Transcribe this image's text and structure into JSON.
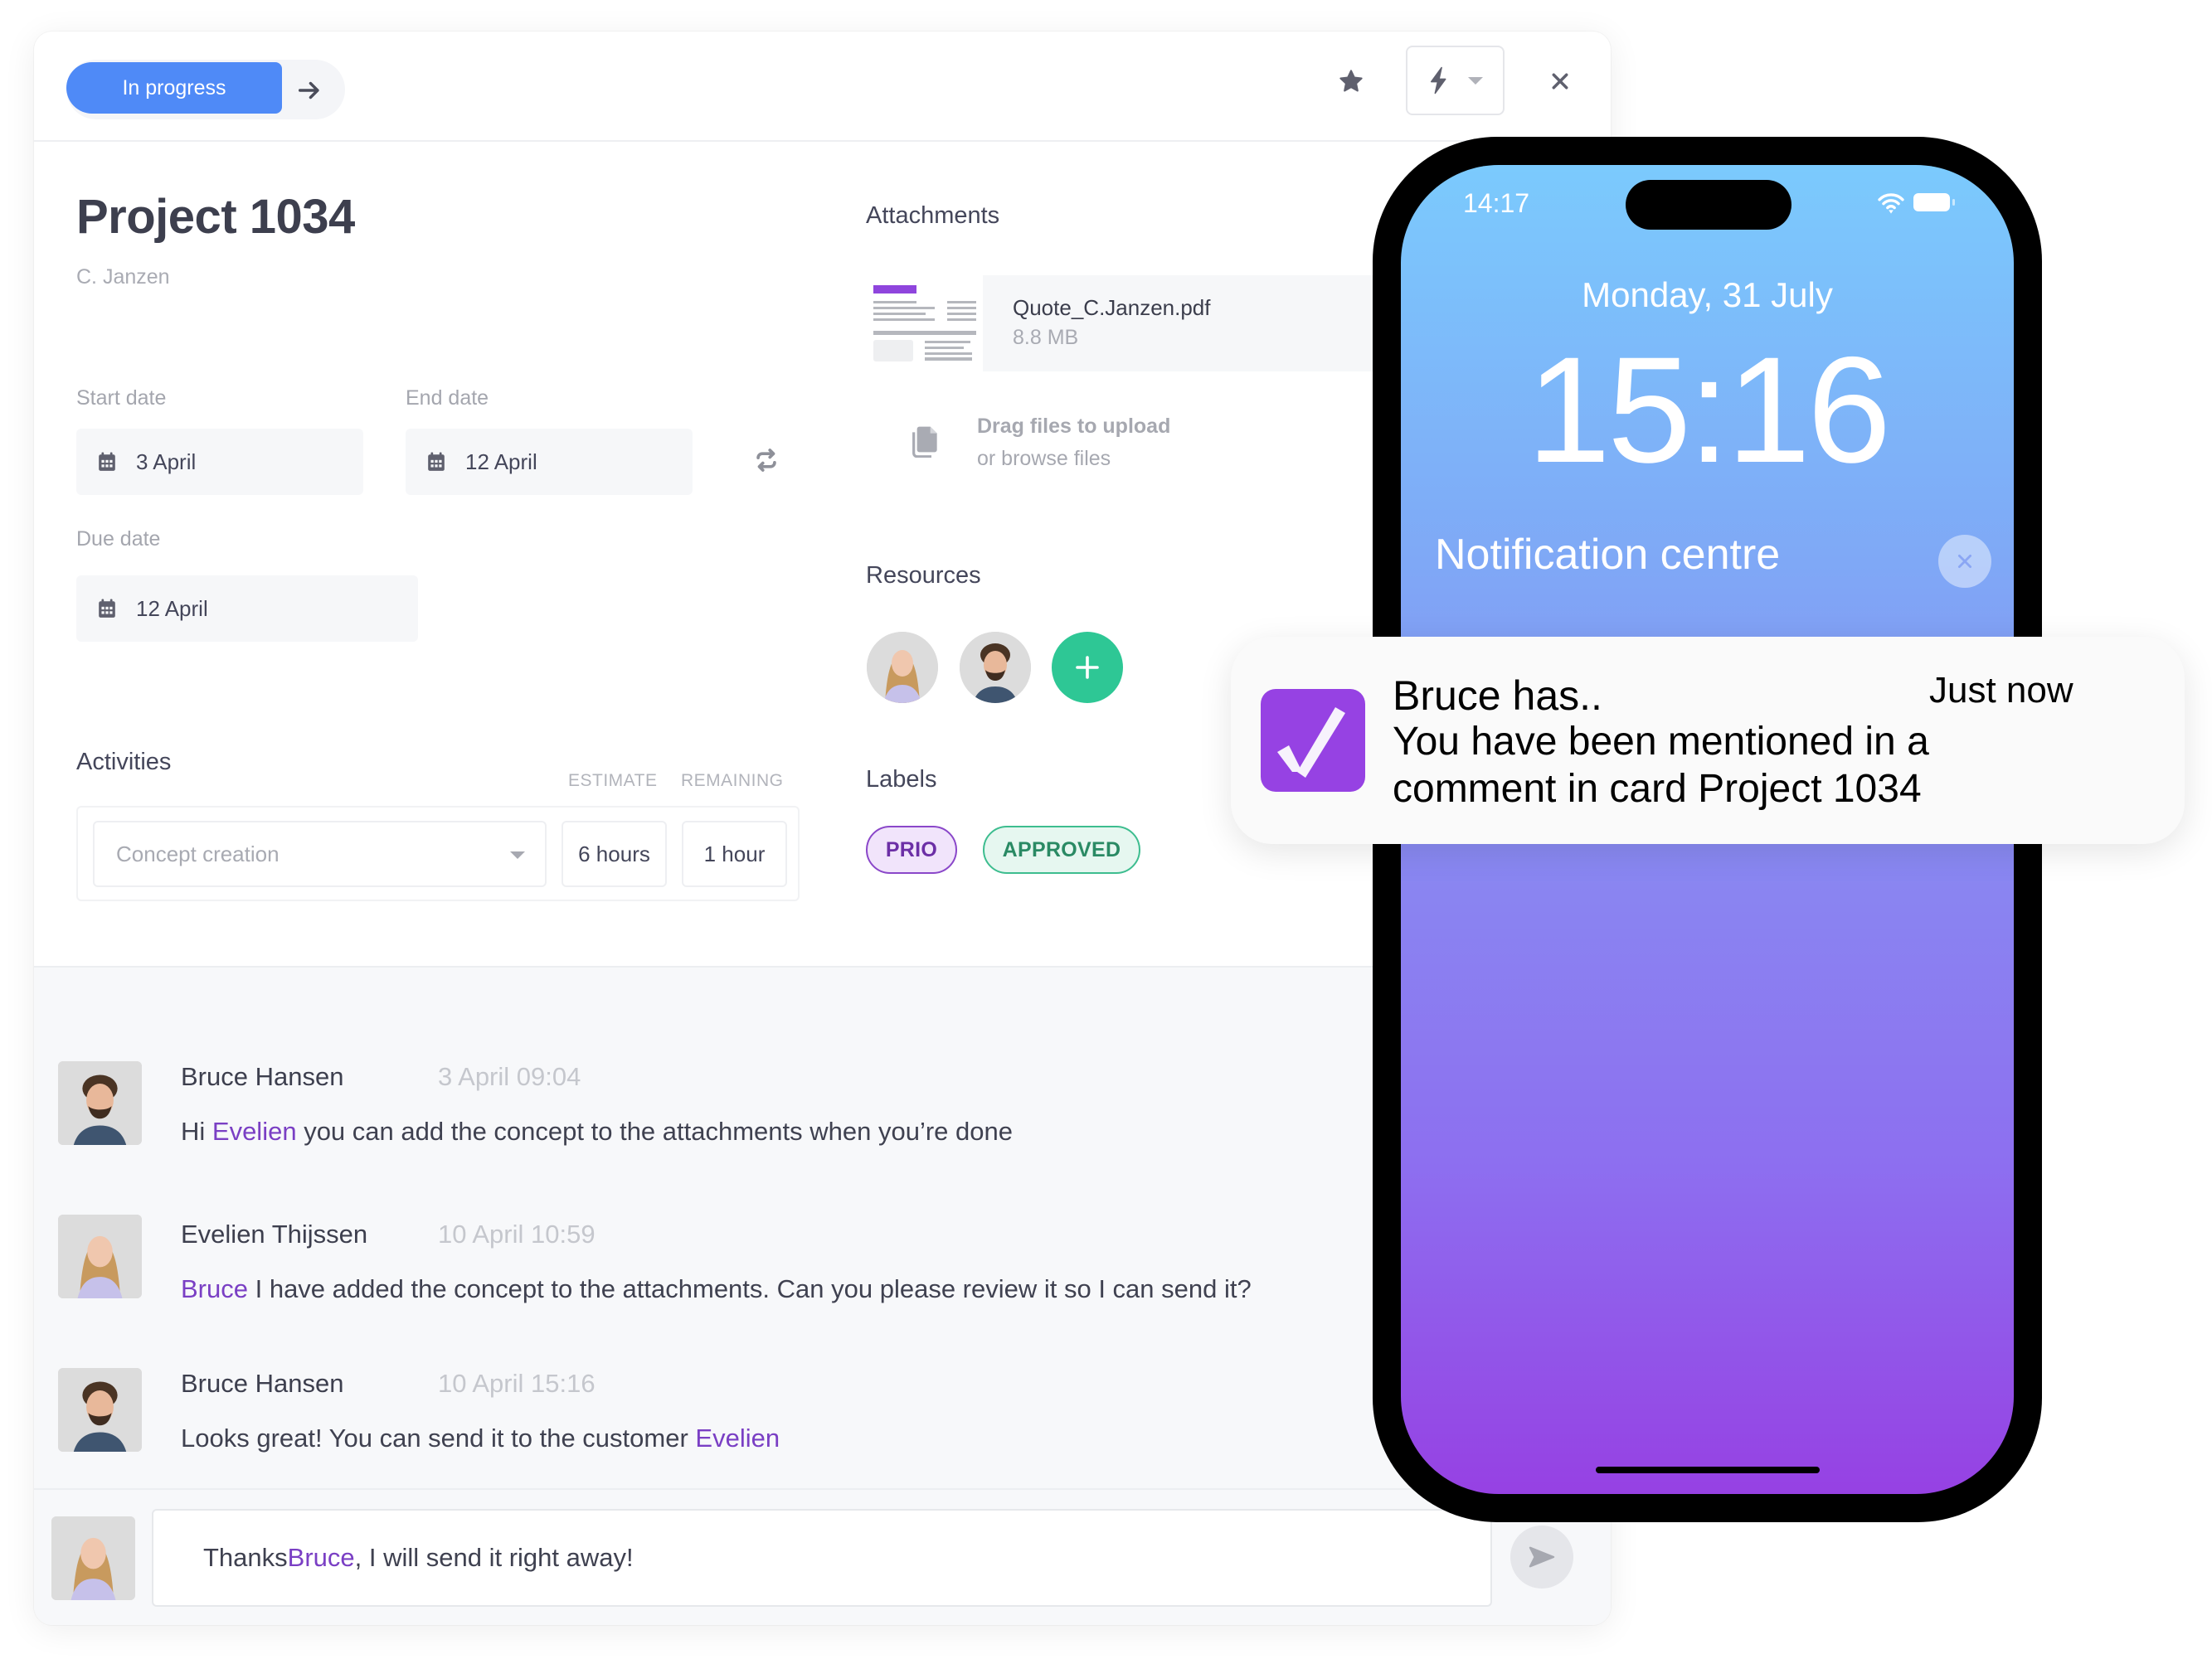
{
  "card": {
    "status": {
      "label": "In progress",
      "color": "#4f8af7",
      "next_icon": "arrow-right-icon"
    },
    "toolbar": {
      "star_icon": "star-icon",
      "automation_icon": "lightning-icon",
      "close_icon": "close-icon"
    },
    "title": "Project 1034",
    "subtitle": "C. Janzen",
    "dates": {
      "start_label": "Start date",
      "start_value": "3 April",
      "end_label": "End date",
      "end_value": "12 April",
      "due_label": "Due date",
      "due_value": "12 April"
    },
    "activities": {
      "title": "Activities",
      "estimate_header": "ESTIMATE",
      "remaining_header": "REMAINING",
      "rows": [
        {
          "activity": "Concept creation",
          "estimate": "6 hours",
          "remaining": "1 hour"
        }
      ]
    },
    "attachments": {
      "title": "Attachments",
      "files": [
        {
          "name": "Quote_C.Janzen.pdf",
          "size": "8.8 MB"
        }
      ],
      "upload_line1": "Drag files to upload",
      "upload_line2": "or browse files"
    },
    "resources": {
      "title": "Resources",
      "people": [
        "Evelien Thijssen",
        "Bruce Hansen"
      ],
      "add_color": "#2ec795"
    },
    "labels": {
      "title": "Labels",
      "items": [
        {
          "text": "PRIO",
          "color": "#8a47c9"
        },
        {
          "text": "APPROVED",
          "color": "#3dbd8f"
        }
      ]
    },
    "comments": [
      {
        "author": "Bruce Hansen",
        "time": "3 April 09:04",
        "pre": "Hi ",
        "mention": "Evelien",
        "post": " you can add the concept to the attachments when you’re done"
      },
      {
        "author": "Evelien Thijssen",
        "time": "10 April 10:59",
        "pre": "",
        "mention": "Bruce",
        "post": " I have added the concept to the attachments. Can you please review it so I can send it?"
      },
      {
        "author": "Bruce Hansen",
        "time": "10 April 15:16",
        "pre": "Looks great! You can send it to the customer ",
        "mention": "Evelien",
        "post": ""
      }
    ],
    "composer": {
      "pre": "Thanks ",
      "mention": "Bruce",
      "post": ", I will send it right away!",
      "send_icon": "send-icon"
    }
  },
  "phone": {
    "status_time": "14:17",
    "date": "Monday, 31 July",
    "clock": "15:16",
    "notification_centre": "Notification centre",
    "notification": {
      "title": "Bruce has..",
      "body": "You have been mentioned in a comment in card Project 1034",
      "time": "Just now",
      "app_color": "#9642e3"
    }
  }
}
